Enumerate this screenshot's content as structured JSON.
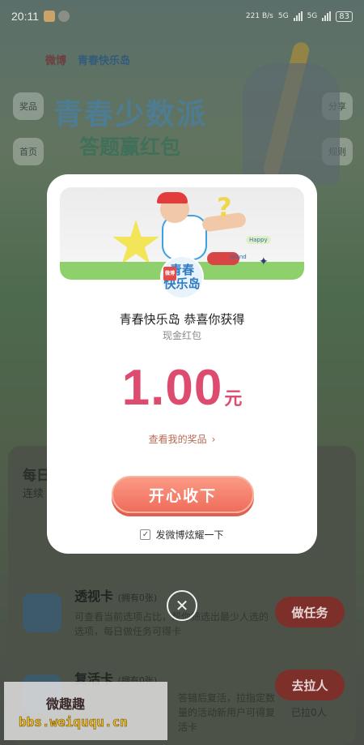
{
  "status_bar": {
    "time": "20:11",
    "network_speed": "221 B/s",
    "sig_1": "5G",
    "sig_2": "5G",
    "battery": "83"
  },
  "brand": {
    "weibo": "微博",
    "island": "青春快乐岛"
  },
  "side_buttons": {
    "prize": "奖品",
    "home": "首页",
    "share": "分享",
    "rules": "规则"
  },
  "hero": {
    "title": "青春少数派",
    "subtitle": "答题赢红包"
  },
  "background": {
    "daily_title": "每日",
    "daily_sub": "连续",
    "cards": [
      {
        "title": "透视卡",
        "owned": "(拥有0张)",
        "desc": "可查看当前选项占比，帮你筛选出最少人选的选项，每日做任务可得卡",
        "button": "做任务"
      },
      {
        "title": "复活卡",
        "owned": "(拥有0张)",
        "desc": "答错后复活，拉指定数量的活动新用户可得复活卡",
        "button": "去拉人",
        "sub": "已拉0人"
      }
    ]
  },
  "modal": {
    "badge_tag": "微博",
    "badge_line1": "青春",
    "badge_line2": "快乐岛",
    "banner_happy": "Happy",
    "banner_island": "island",
    "congrats": "青春快乐岛 恭喜你获得",
    "prize_type": "现金红包",
    "amount": "1.00",
    "unit": "元",
    "view_prize": "查看我的奖品",
    "accept_button": "开心收下",
    "share_checkbox_label": "发微博炫耀一下",
    "share_checked": true
  },
  "close_icon": "close-icon",
  "watermark": {
    "name": "微趣趣",
    "url": "bbs.weiququ.cn"
  }
}
